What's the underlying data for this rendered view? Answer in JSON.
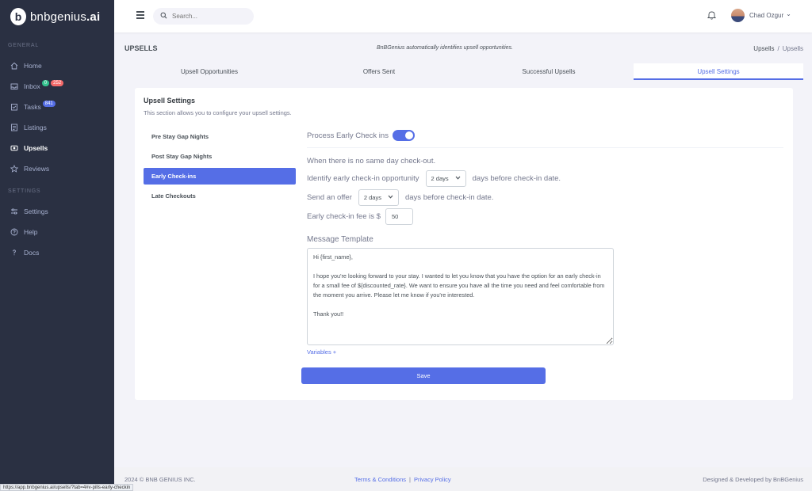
{
  "app": {
    "logo_letter": "b",
    "logo_text": "bnbgenius",
    "logo_suffix": ".ai"
  },
  "sidebar": {
    "section_general": "GENERAL",
    "section_settings": "SETTINGS",
    "items": [
      {
        "label": "Home",
        "icon": "home-icon"
      },
      {
        "label": "Inbox",
        "icon": "inbox-icon",
        "badges": [
          "0",
          "252"
        ]
      },
      {
        "label": "Tasks",
        "icon": "tasks-icon",
        "badges": [
          "841"
        ]
      },
      {
        "label": "Listings",
        "icon": "listings-icon"
      },
      {
        "label": "Upsells",
        "icon": "upsells-icon",
        "active": true
      },
      {
        "label": "Reviews",
        "icon": "star-icon"
      },
      {
        "label": "Settings",
        "icon": "sliders-icon"
      },
      {
        "label": "Help",
        "icon": "help-icon"
      },
      {
        "label": "Docs",
        "icon": "question-icon"
      }
    ]
  },
  "topbar": {
    "search_placeholder": "Search...",
    "user_name": "Chad Ozgur",
    "user_chevron": "⌄"
  },
  "header": {
    "title": "UPSELLS",
    "subtitle": "BnBGenius automatically identifies upsell opportunities.",
    "breadcrumb": [
      "Upsells",
      "Upsells"
    ],
    "breadcrumb_sep": "/"
  },
  "tabs": [
    {
      "label": "Upsell Opportunities"
    },
    {
      "label": "Offers Sent"
    },
    {
      "label": "Successful Upsells"
    },
    {
      "label": "Upsell Settings",
      "active": true
    }
  ],
  "card": {
    "title": "Upsell Settings",
    "description": "This section allows you to configure your upsell settings.",
    "pills": [
      {
        "label": "Pre Stay Gap Nights"
      },
      {
        "label": "Post Stay Gap Nights"
      },
      {
        "label": "Early Check-ins",
        "active": true
      },
      {
        "label": "Late Checkouts"
      }
    ]
  },
  "early_checkin": {
    "toggle_label": "Process Early Check ins",
    "toggle_on": true,
    "no_checkout_text": "When there is no same day check-out.",
    "identify_prefix": "Identify early check-in opportunity",
    "identify_value": "2 days",
    "identify_suffix": "days before check-in date.",
    "offer_prefix": "Send an offer",
    "offer_value": "2 days",
    "offer_suffix": "days before check-in date.",
    "fee_label": "Early check-in fee is $",
    "fee_value": "50",
    "message_label": "Message Template",
    "message": "Hi {first_name},\n\nI hope you're looking forward to your stay. I wanted to let you know that you have the option for an early check-in for a small fee of ${discounted_rate}. We want to ensure you have all the time you need and feel comfortable from the moment you arrive. Please let me know if you're interested.\n\nThank you!!",
    "variables_link": "Variables +",
    "save_label": "Save"
  },
  "footer": {
    "copyright": "2024 © BNB GENIUS INC.",
    "terms": "Terms & Conditions",
    "divider": "|",
    "privacy": "Privacy Policy",
    "designed_by": "Designed & Developed by BnBGenius"
  },
  "status_bar": {
    "url": "https://app.bnbgenius.ai/upsells/?tab=4#v-pills-early-checkin"
  },
  "colors": {
    "primary": "#556ee6",
    "sidebar_bg": "#2a3042",
    "badge_green": "#34c38f",
    "badge_red": "#f46a6a"
  }
}
